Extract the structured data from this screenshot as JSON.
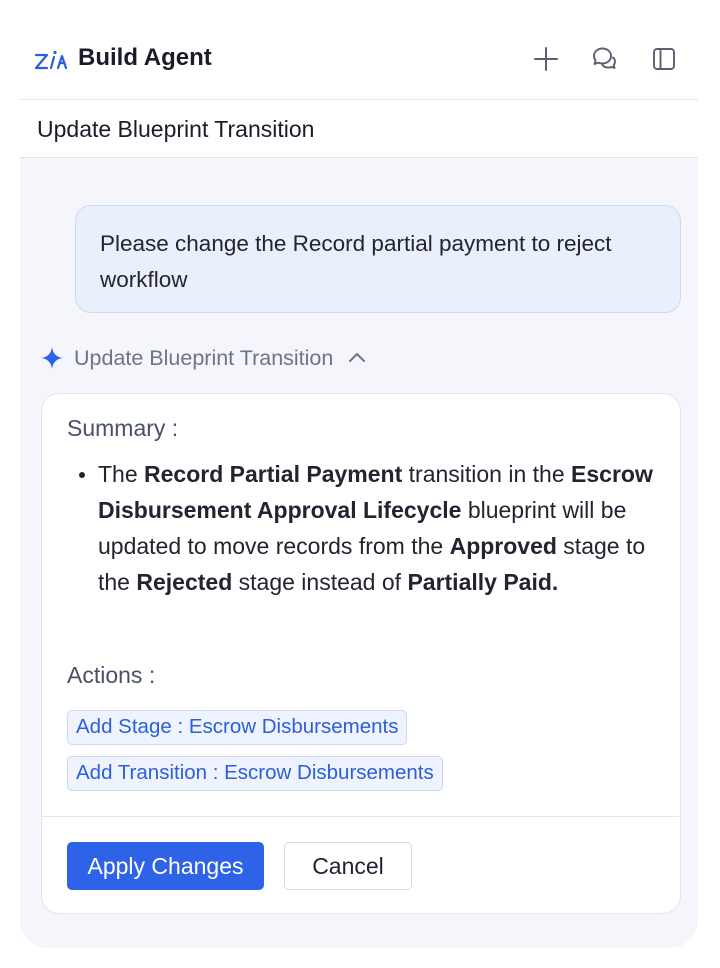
{
  "header": {
    "title": "Build Agent",
    "icons": [
      "logo-icon",
      "plus-icon",
      "chat-bubbles-icon",
      "sidebar-toggle-icon"
    ]
  },
  "subheader": {
    "title": "Update Blueprint Transition"
  },
  "chat": {
    "user_message": "Please change the Record partial payment to reject workflow",
    "tool_call": {
      "label": "Update Blueprint Transition",
      "icon": "sparkle-icon",
      "expanded": true
    }
  },
  "card": {
    "summary_label": "Summary :",
    "summary": {
      "t1": "The ",
      "b1": "Record Partial Payment",
      "t2": " transition in the ",
      "b2": "Escrow Disbursement Approval Lifecycle",
      "t3": " blueprint will be updated to move records from the ",
      "b3": "Approved",
      "t4": " stage to the ",
      "b4": "Rejected",
      "t5": " stage instead of ",
      "b5": "Partially Paid."
    },
    "actions_label": "Actions :",
    "actions": [
      "Add Stage : Escrow Disbursements",
      "Add Transition : Escrow Disbursements"
    ],
    "apply_label": "Apply Changes",
    "cancel_label": "Cancel"
  },
  "colors": {
    "accent": "#2e62e7",
    "chip_text": "#2b5fdc",
    "chat_background": "#f4f6fc",
    "user_bubble": "#eaf0fb"
  }
}
